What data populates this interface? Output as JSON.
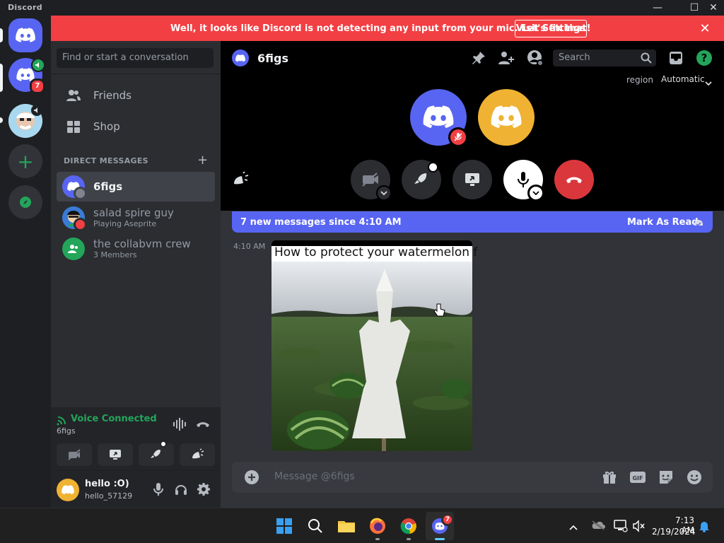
{
  "window": {
    "title": "Discord"
  },
  "banner": {
    "message": "Well, it looks like Discord is not detecting any input from your mic. Let's fix that!",
    "button": "Visit Settings",
    "close_glyph": "✕"
  },
  "servers": [
    {
      "name": "home",
      "badge": ""
    },
    {
      "name": "voice-server",
      "badge": "7"
    },
    {
      "name": "character-server",
      "badge": ""
    }
  ],
  "sidebar": {
    "search_placeholder": "Find or start a conversation",
    "nav": [
      {
        "label": "Friends",
        "icon": "friends-icon"
      },
      {
        "label": "Shop",
        "icon": "shop-icon"
      }
    ],
    "dm_header": "DIRECT MESSAGES",
    "dm_add": "+",
    "dms": [
      {
        "name": "6figs",
        "sub": "",
        "status_color": "#80848e"
      },
      {
        "name": "salad spire guy",
        "sub": "Playing Aseprite",
        "status_color": "#f23f43"
      },
      {
        "name": "the collabvm crew",
        "sub": "3 Members",
        "status_color": ""
      }
    ]
  },
  "voice_panel": {
    "status": "Voice Connected",
    "channel": "6figs"
  },
  "user_panel": {
    "name": "hello :O)",
    "tag": "hello_57129"
  },
  "call": {
    "channel_name": "6figs",
    "search_placeholder": "Search",
    "region_label": "region",
    "region_value": "Automatic"
  },
  "chat": {
    "new_messages": "7 new messages since 4:10 AM",
    "mark_read": "Mark As Read",
    "message_time": "4:10 AM",
    "media_caption": "How to protect your watermelon f",
    "input_placeholder": "Message @6figs"
  },
  "taskbar": {
    "time": "7:13 AM",
    "date": "2/19/2024",
    "discord_badge": "7"
  },
  "colors": {
    "blurple": "#5865f2",
    "red": "#f23f43",
    "green": "#23a55a",
    "orange": "#f0b232"
  }
}
